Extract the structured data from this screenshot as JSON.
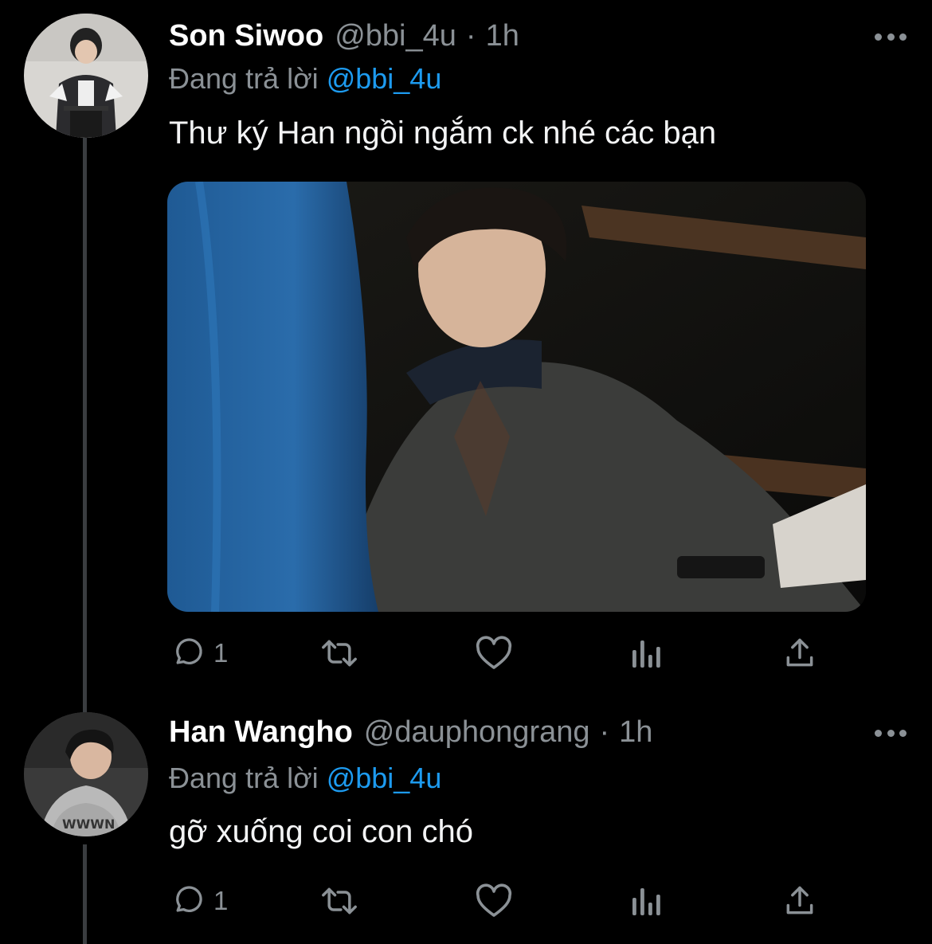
{
  "tweets": [
    {
      "display_name": "Son Siwoo",
      "handle": "@bbi_4u",
      "separator": "·",
      "time": "1h",
      "replying_prefix": "Đang trả lời",
      "replying_to": "@bbi_4u",
      "text": "Thư ký Han ngồi ngắm ck nhé các bạn",
      "has_media": true,
      "reply_count": "1",
      "avatar_icon": "avatar-person-podium"
    },
    {
      "display_name": "Han Wangho",
      "handle": "@dauphongrang",
      "separator": "·",
      "time": "1h",
      "replying_prefix": "Đang trả lời",
      "replying_to": "@bbi_4u",
      "text": "gỡ xuống coi con chó",
      "has_media": false,
      "reply_count": "1",
      "avatar_icon": "avatar-person-hoodie"
    }
  ],
  "icons": {
    "reply": "reply-icon",
    "retweet": "retweet-icon",
    "like": "like-icon",
    "views": "views-icon",
    "share": "share-icon",
    "more": "more-icon"
  },
  "colors": {
    "background": "#000000",
    "primary_text": "#e7e9ea",
    "secondary_text": "#8b9196",
    "mention": "#1d9bf0",
    "thread_line": "#3a3d40"
  }
}
